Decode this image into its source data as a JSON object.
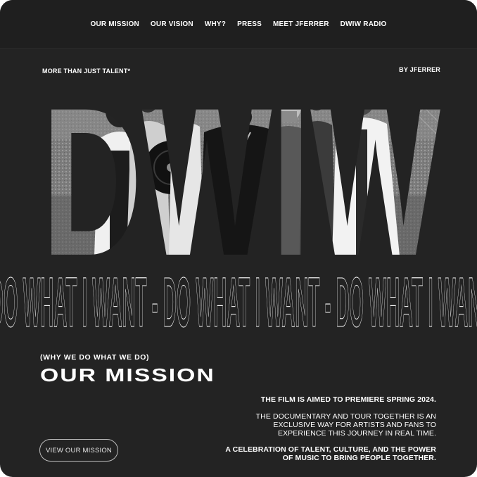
{
  "nav": {
    "items": [
      "OUR MISSION",
      "OUR VISION",
      "WHY?",
      "PRESS",
      "MEET JFERRER",
      "DWIW RADIO"
    ]
  },
  "hero": {
    "tagline": "MORE THAN JUST TALENT*",
    "byline": "BY JFERRER",
    "logo_text": "DWIW",
    "marquee_text": "DO WHAT I WANT - DO WHAT I WANT - DO WHAT I WANT - DO WHAT I WANT"
  },
  "mission": {
    "subhead": "(WHY WE DO WHAT WE DO)",
    "title": "OUR MISSION",
    "button_label": "VIEW OUR MISSION",
    "premiere": "THE FILM IS AIMED TO PREMIERE SPRING 2024.",
    "description": "THE DOCUMENTARY AND TOUR TOGETHER IS AN EXCLUSIVE WAY FOR ARTISTS AND FANS TO EXPERIENCE THIS JOURNEY IN REAL TIME.",
    "celebration": "A CELEBRATION OF TALENT, CULTURE, AND THE POWER OF MUSIC TO BRING PEOPLE TOGETHER."
  },
  "colors": {
    "background": "#232323",
    "nav_background": "#1f1f1f",
    "text": "#ffffff"
  }
}
